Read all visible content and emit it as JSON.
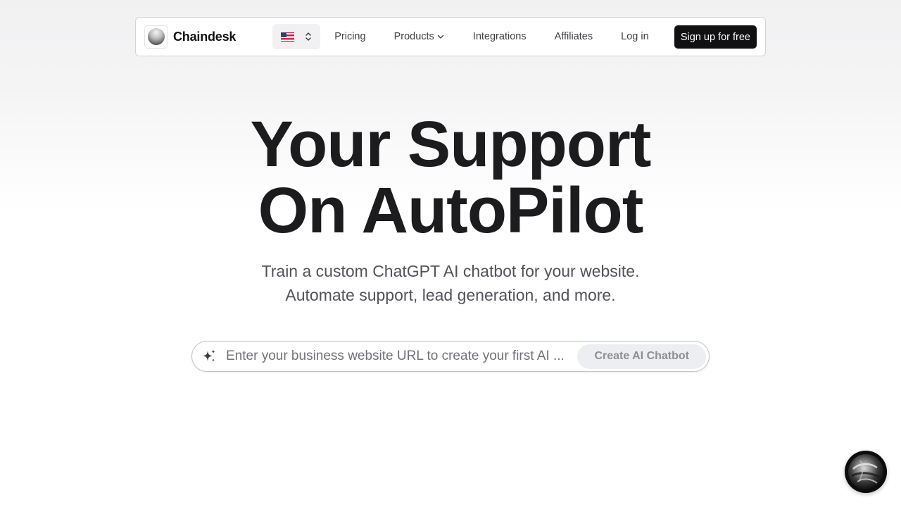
{
  "navbar": {
    "brand": "Chaindesk",
    "language": {
      "flag": "🇺🇸",
      "icon": "us-flag-icon"
    },
    "links": [
      "Pricing",
      "Products",
      "Integrations",
      "Affiliates",
      "Log in"
    ],
    "signup_label": "Sign up for free"
  },
  "hero": {
    "title_line1": "Your Support",
    "title_line2": "On AutoPilot",
    "subtitle_line1": "Train a custom ChatGPT AI chatbot for your website.",
    "subtitle_line2": "Automate support, lead generation, and more."
  },
  "url_form": {
    "placeholder": "Enter your business website URL to create your first AI ...",
    "value": "",
    "button_label": "Create AI Chatbot",
    "icon": "sparkles-icon"
  },
  "chat_widget": {
    "icon": "chat-avatar-icon"
  },
  "colors": {
    "primary_dark": "#111113",
    "text": "#18181b",
    "muted": "#52525b",
    "button_disabled_bg": "#eceef1"
  }
}
